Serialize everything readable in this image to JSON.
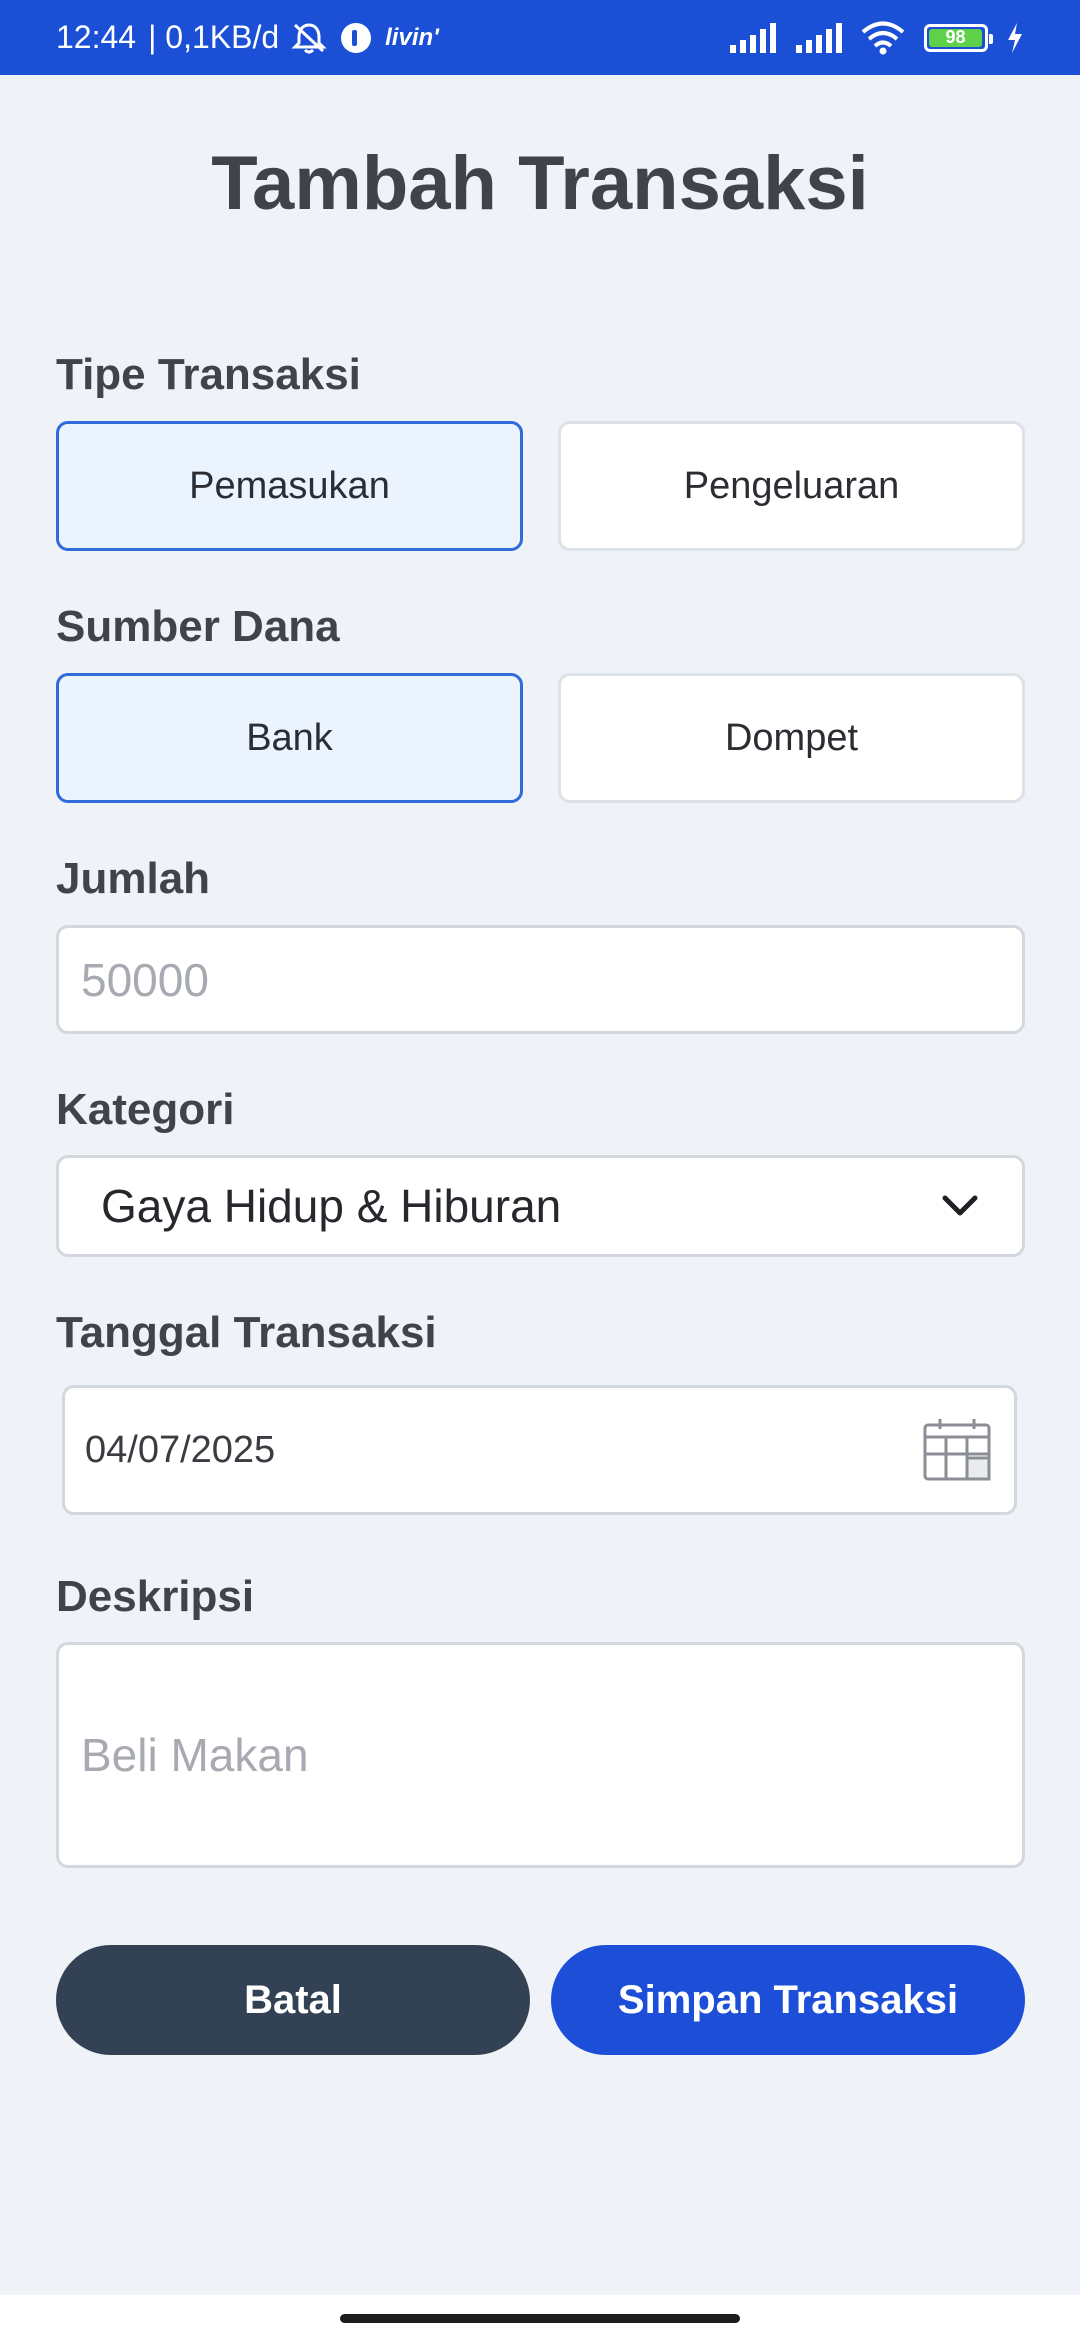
{
  "status_bar": {
    "time": "12:44",
    "network_speed": "| 0,1KB/d",
    "app_text": "livin'",
    "battery_level": "98",
    "battery_percent": 98,
    "icons": [
      "alarm-off-icon",
      "livin-app-icon",
      "signal-icon",
      "signal-icon",
      "wifi-icon",
      "battery-icon",
      "charging-icon"
    ]
  },
  "page": {
    "title": "Tambah Transaksi"
  },
  "form": {
    "type_label": "Tipe Transaksi",
    "type_options": [
      "Pemasukan",
      "Pengeluaran"
    ],
    "type_selected": "Pemasukan",
    "source_label": "Sumber Dana",
    "source_options": [
      "Bank",
      "Dompet"
    ],
    "source_selected": "Bank",
    "amount_label": "Jumlah",
    "amount_placeholder": "50000",
    "category_label": "Kategori",
    "category_value": "Gaya Hidup & Hiburan",
    "date_label": "Tanggal Transaksi",
    "date_value": "04/07/2025",
    "description_label": "Deskripsi",
    "description_placeholder": "Beli Makan"
  },
  "actions": {
    "cancel_label": "Batal",
    "save_label": "Simpan Transaksi"
  },
  "colors": {
    "status_bar": "#1a4fd6",
    "background": "#eff2f7",
    "active_border": "#2f6bd9",
    "active_fill": "#eaf3fe",
    "cancel_button": "#334155",
    "save_button": "#1d4ed8"
  }
}
